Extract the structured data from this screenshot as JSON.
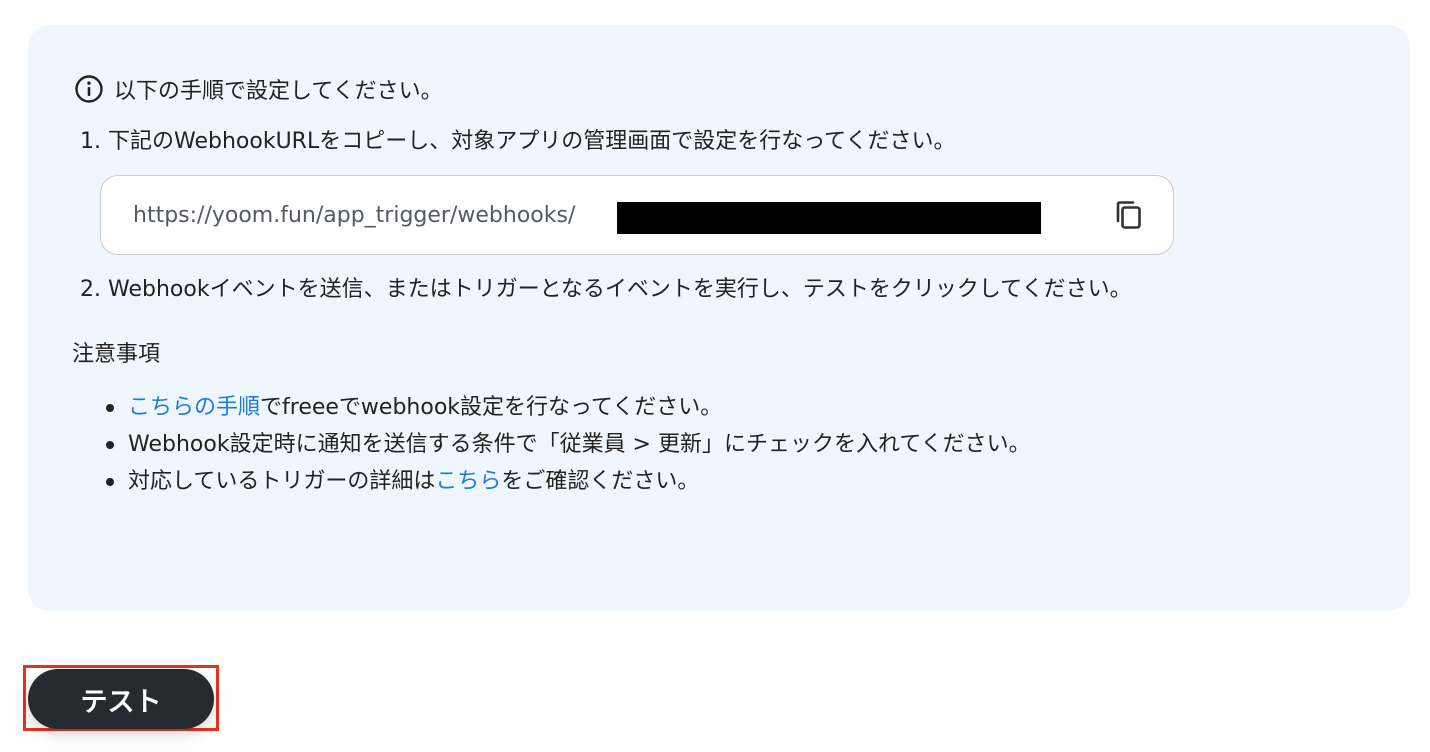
{
  "header": {
    "icon": "info-icon",
    "text": "以下の手順で設定してください。"
  },
  "steps": [
    {
      "num": "1.",
      "text": "下記のWebhookURLをコピーし、対象アプリの管理画面で設定を行なってください。"
    },
    {
      "num": "2.",
      "text": "Webhookイベントを送信、またはトリガーとなるイベントを実行し、テストをクリックしてください。"
    }
  ],
  "webhook": {
    "url_prefix": "https://yoom.fun/app_trigger/webhooks/",
    "copy_icon": "copy-icon"
  },
  "notes": {
    "title": "注意事項",
    "items": [
      {
        "link": "こちらの手順",
        "text": "でfreeeでwebhook設定を行なってください。"
      },
      {
        "text": "Webhook設定時に通知を送信する条件で「従業員 > 更新」にチェックを入れてください。"
      },
      {
        "before": "対応しているトリガーの詳細は",
        "link": "こちら",
        "after": "をご確認ください。"
      }
    ]
  },
  "test_button": {
    "label": "テスト"
  },
  "colors": {
    "panel_bg": "#eff6fe",
    "link": "#1f7ae0",
    "button_bg": "#262b31",
    "highlight": "#e8321d"
  }
}
